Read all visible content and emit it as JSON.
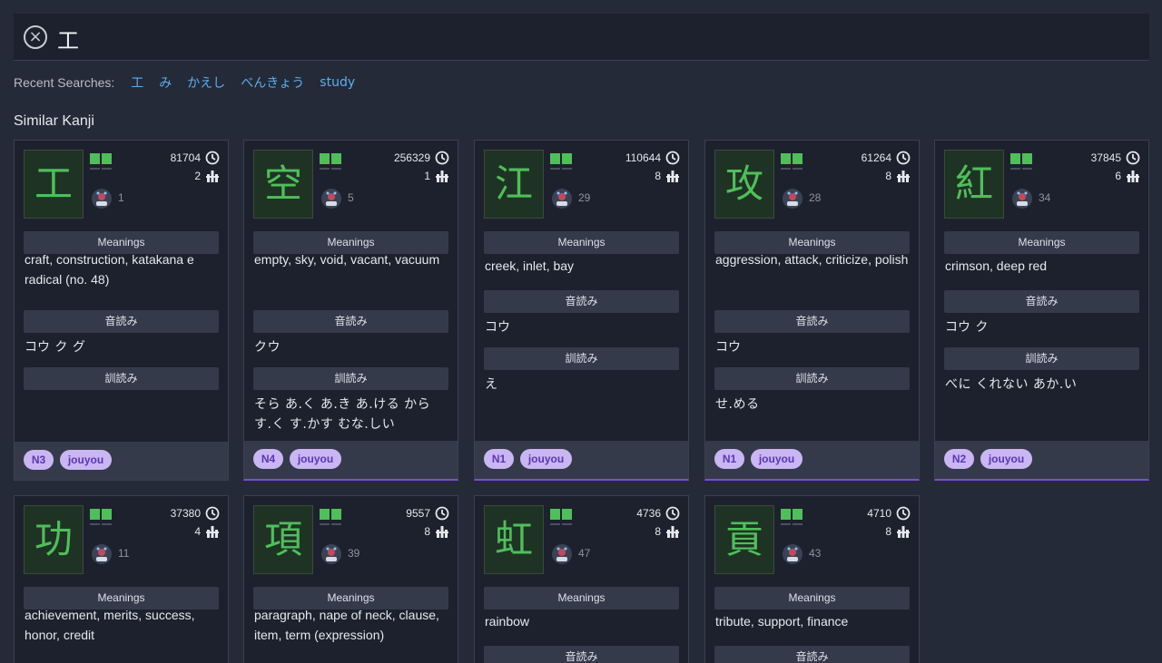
{
  "search": {
    "clear_icon": "close-circle-icon",
    "query": "工"
  },
  "recent": {
    "label": "Recent Searches:",
    "items": [
      "工",
      "み",
      "かえし",
      "べんきょう",
      "study"
    ]
  },
  "section_title": "Similar Kanji",
  "labels": {
    "meanings": "Meanings",
    "onyomi": "音読み",
    "kunyomi": "訓読み"
  },
  "cards": [
    {
      "kanji": "工",
      "freq": "81704",
      "strokes": "2",
      "rank": "1",
      "meanings": "craft, construction, katakana e radical (no. 48)",
      "onyomi": "コウ ク グ",
      "kunyomi": "",
      "jlpt": "N3",
      "grade": "jouyou"
    },
    {
      "kanji": "空",
      "freq": "256329",
      "strokes": "1",
      "rank": "5",
      "meanings": "empty, sky, void, vacant, vacuum",
      "onyomi": "クウ",
      "kunyomi": "そら あ.く あ.き あ.ける から す.く す.かす むな.しい",
      "jlpt": "N4",
      "grade": "jouyou"
    },
    {
      "kanji": "江",
      "freq": "110644",
      "strokes": "8",
      "rank": "29",
      "meanings": "creek, inlet, bay",
      "onyomi": "コウ",
      "kunyomi": "え",
      "jlpt": "N1",
      "grade": "jouyou"
    },
    {
      "kanji": "攻",
      "freq": "61264",
      "strokes": "8",
      "rank": "28",
      "meanings": "aggression, attack, criticize, polish",
      "onyomi": "コウ",
      "kunyomi": "せ.める",
      "jlpt": "N1",
      "grade": "jouyou"
    },
    {
      "kanji": "紅",
      "freq": "37845",
      "strokes": "6",
      "rank": "34",
      "meanings": "crimson, deep red",
      "onyomi": "コウ ク",
      "kunyomi": "べに くれない あか.い",
      "jlpt": "N2",
      "grade": "jouyou"
    },
    {
      "kanji": "功",
      "freq": "37380",
      "strokes": "4",
      "rank": "11",
      "meanings": "achievement, merits, success, honor, credit"
    },
    {
      "kanji": "項",
      "freq": "9557",
      "strokes": "8",
      "rank": "39",
      "meanings": "paragraph, nape of neck, clause, item, term (expression)"
    },
    {
      "kanji": "虹",
      "freq": "4736",
      "strokes": "8",
      "rank": "47",
      "meanings": "rainbow"
    },
    {
      "kanji": "貢",
      "freq": "4710",
      "strokes": "8",
      "rank": "43",
      "meanings": "tribute, support, finance"
    }
  ],
  "colors": {
    "kanji_green": "#4fbf5a",
    "link_blue": "#5aaef0",
    "tag_bg": "#c9b6f2",
    "tag_text": "#5d35b5",
    "accent_purple": "#7b4dd6"
  }
}
